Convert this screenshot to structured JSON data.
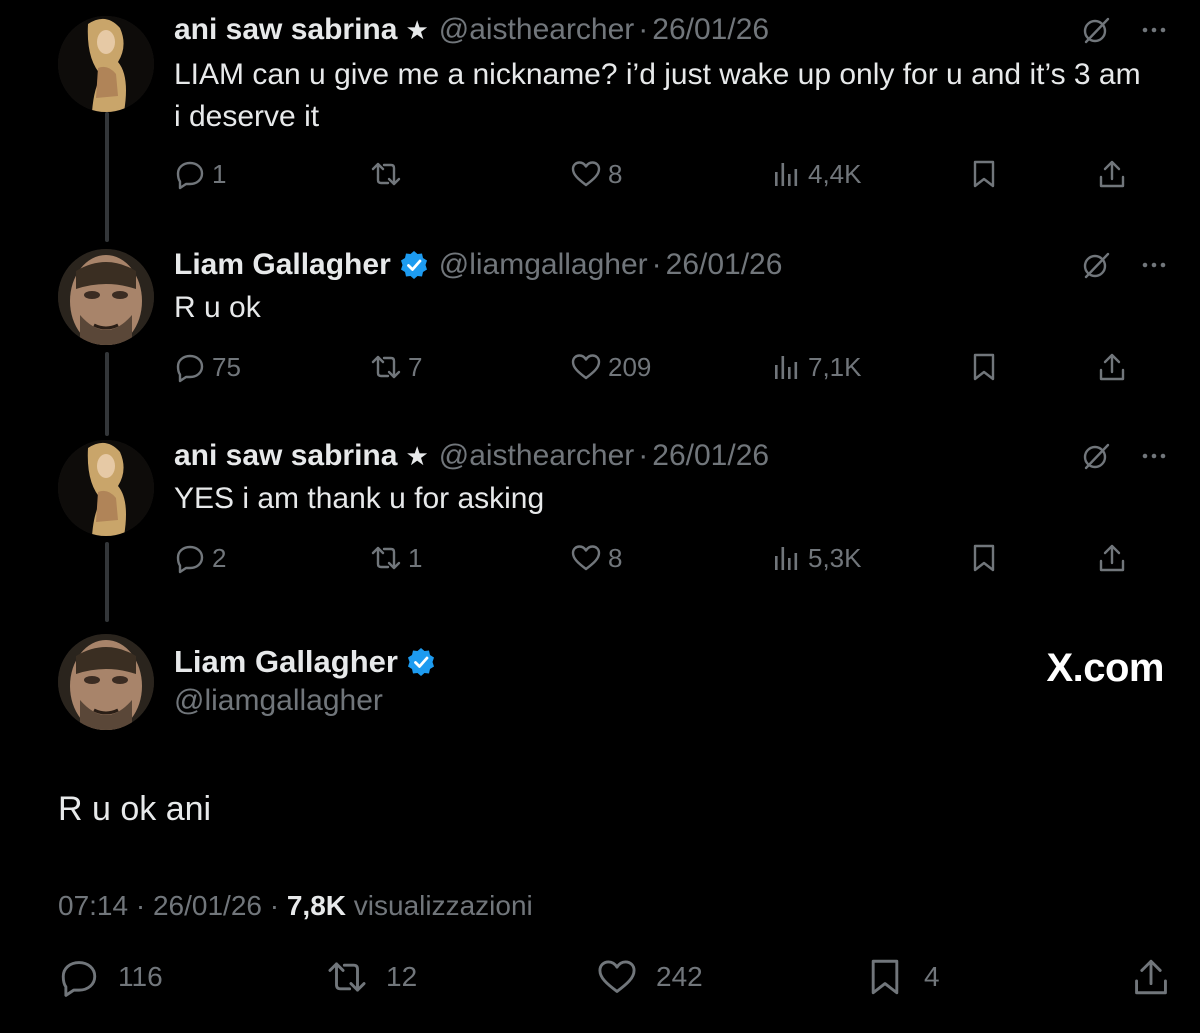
{
  "tweets": [
    {
      "name": "ani saw sabrina",
      "badge": "★",
      "handle": "@aisthearcher",
      "date": "26/01/26",
      "text": "LIAM can u give me a nickname? i’d just wake up only for u and it’s 3 am i deserve it",
      "replies": "1",
      "retweets": "",
      "likes": "8",
      "views": "4,4K"
    },
    {
      "name": "Liam Gallagher",
      "badge": "verified",
      "handle": "@liamgallagher",
      "date": "26/01/26",
      "text": "R u ok",
      "replies": "75",
      "retweets": "7",
      "likes": "209",
      "views": "7,1K"
    },
    {
      "name": "ani saw sabrina",
      "badge": "★",
      "handle": "@aisthearcher",
      "date": "26/01/26",
      "text": "YES i am thank u for asking",
      "replies": "2",
      "retweets": "1",
      "likes": "8",
      "views": "5,3K"
    }
  ],
  "main": {
    "name": "Liam Gallagher",
    "handle": "@liamgallagher",
    "text": "R u ok ani",
    "time": "07:14",
    "date": "26/01/26",
    "views": "7,8K",
    "views_label": "visualizzazioni",
    "replies": "116",
    "retweets": "12",
    "likes": "242",
    "bookmarks": "4"
  },
  "watermark": "X.com",
  "separator": "·",
  "icons": [
    "reply-icon",
    "retweet-icon",
    "like-icon",
    "views-icon",
    "bookmark-icon",
    "share-icon",
    "grok-icon",
    "more-icon",
    "verified-icon"
  ],
  "colors": {
    "background": "#000000",
    "text": "#e7e9ea",
    "muted": "#71767b",
    "verified": "#1d9bf0"
  }
}
